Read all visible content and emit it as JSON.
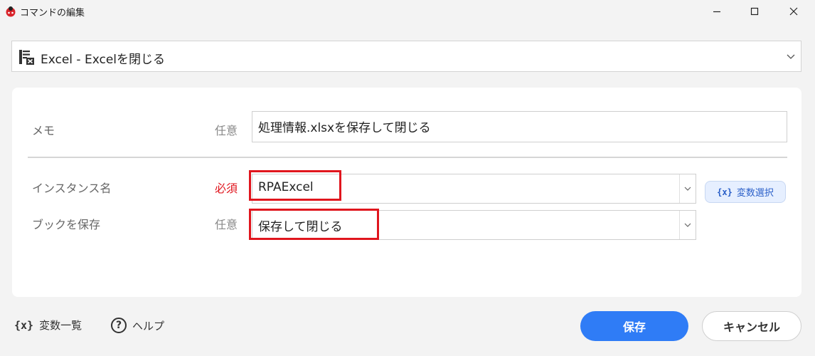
{
  "window": {
    "title": "コマンドの編集",
    "icons": {
      "app": "ladybug-app-icon",
      "minimize": "minimize-icon",
      "maximize": "maximize-icon",
      "close": "close-icon"
    }
  },
  "command": {
    "selected": "Excel - Excelを閉じる",
    "icon": "excel-icon"
  },
  "form": {
    "memo": {
      "label": "メモ",
      "req": "任意",
      "value": "処理情報.xlsxを保存して閉じる"
    },
    "instance": {
      "label": "インスタンス名",
      "req": "必須",
      "value": "RPAExcel"
    },
    "save": {
      "label": "ブックを保存",
      "req": "任意",
      "value": "保存して閉じる"
    },
    "var_select": {
      "prefix": "{x}",
      "label": "変数選択"
    }
  },
  "footer": {
    "var_list": {
      "prefix": "{x}",
      "label": "変数一覧"
    },
    "help": {
      "icon_text": "?",
      "label": "ヘルプ"
    },
    "save_label": "保存",
    "cancel_label": "キャンセル"
  },
  "colors": {
    "primary": "#2f7cf6",
    "required": "#e0161e",
    "highlight": "#e0161e"
  }
}
